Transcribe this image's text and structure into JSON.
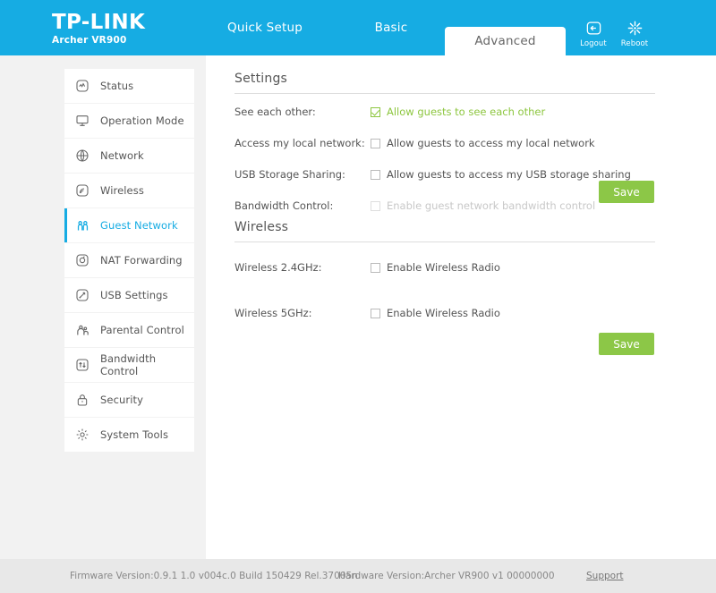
{
  "header": {
    "brand": "TP-LINK",
    "model": "Archer VR900",
    "tabs": [
      {
        "label": "Quick Setup",
        "active": false
      },
      {
        "label": "Basic",
        "active": false
      },
      {
        "label": "Advanced",
        "active": true
      }
    ],
    "actions": [
      {
        "label": "Logout",
        "icon": "logout-icon"
      },
      {
        "label": "Reboot",
        "icon": "reboot-icon"
      }
    ]
  },
  "sidebar": {
    "items": [
      {
        "label": "Status",
        "icon": "status-icon",
        "active": false
      },
      {
        "label": "Operation Mode",
        "icon": "monitor-icon",
        "active": false
      },
      {
        "label": "Network",
        "icon": "globe-icon",
        "active": false
      },
      {
        "label": "Wireless",
        "icon": "wireless-icon",
        "active": false
      },
      {
        "label": "Guest Network",
        "icon": "guest-network-icon",
        "active": true
      },
      {
        "label": "NAT Forwarding",
        "icon": "nat-forwarding-icon",
        "active": false
      },
      {
        "label": "USB Settings",
        "icon": "usb-icon",
        "active": false
      },
      {
        "label": "Parental Control",
        "icon": "parental-control-icon",
        "active": false
      },
      {
        "label": "Bandwidth Control",
        "icon": "bandwidth-control-icon",
        "active": false
      },
      {
        "label": "Security",
        "icon": "lock-icon",
        "active": false
      },
      {
        "label": "System Tools",
        "icon": "gear-icon",
        "active": false
      }
    ]
  },
  "main": {
    "settings": {
      "title": "Settings",
      "rows": [
        {
          "label": "See each other:",
          "checkbox_label": "Allow guests to see each other",
          "checked": true,
          "disabled": false
        },
        {
          "label": "Access my local network:",
          "checkbox_label": "Allow guests to access my local network",
          "checked": false,
          "disabled": false
        },
        {
          "label": "USB Storage Sharing:",
          "checkbox_label": "Allow guests to access my USB storage sharing",
          "checked": false,
          "disabled": false
        },
        {
          "label": "Bandwidth Control:",
          "checkbox_label": "Enable guest network bandwidth control",
          "checked": false,
          "disabled": true
        }
      ],
      "save_label": "Save"
    },
    "wireless": {
      "title": "Wireless",
      "rows": [
        {
          "label": "Wireless 2.4GHz:",
          "checkbox_label": "Enable Wireless Radio",
          "checked": false,
          "disabled": false
        },
        {
          "label": "Wireless 5GHz:",
          "checkbox_label": "Enable Wireless Radio",
          "checked": false,
          "disabled": false
        }
      ],
      "save_label": "Save"
    }
  },
  "footer": {
    "firmware": "Firmware Version:0.9.1 1.0 v004c.0 Build 150429 Rel.37005n",
    "hardware": "Hardware Version:Archer VR900 v1 00000000",
    "support": "Support"
  },
  "colors": {
    "header_blue": "#16ace3",
    "accent_green": "#8cc747",
    "sidebar_bg": "#f2f2f2",
    "footer_bg": "#e8e8e8"
  }
}
